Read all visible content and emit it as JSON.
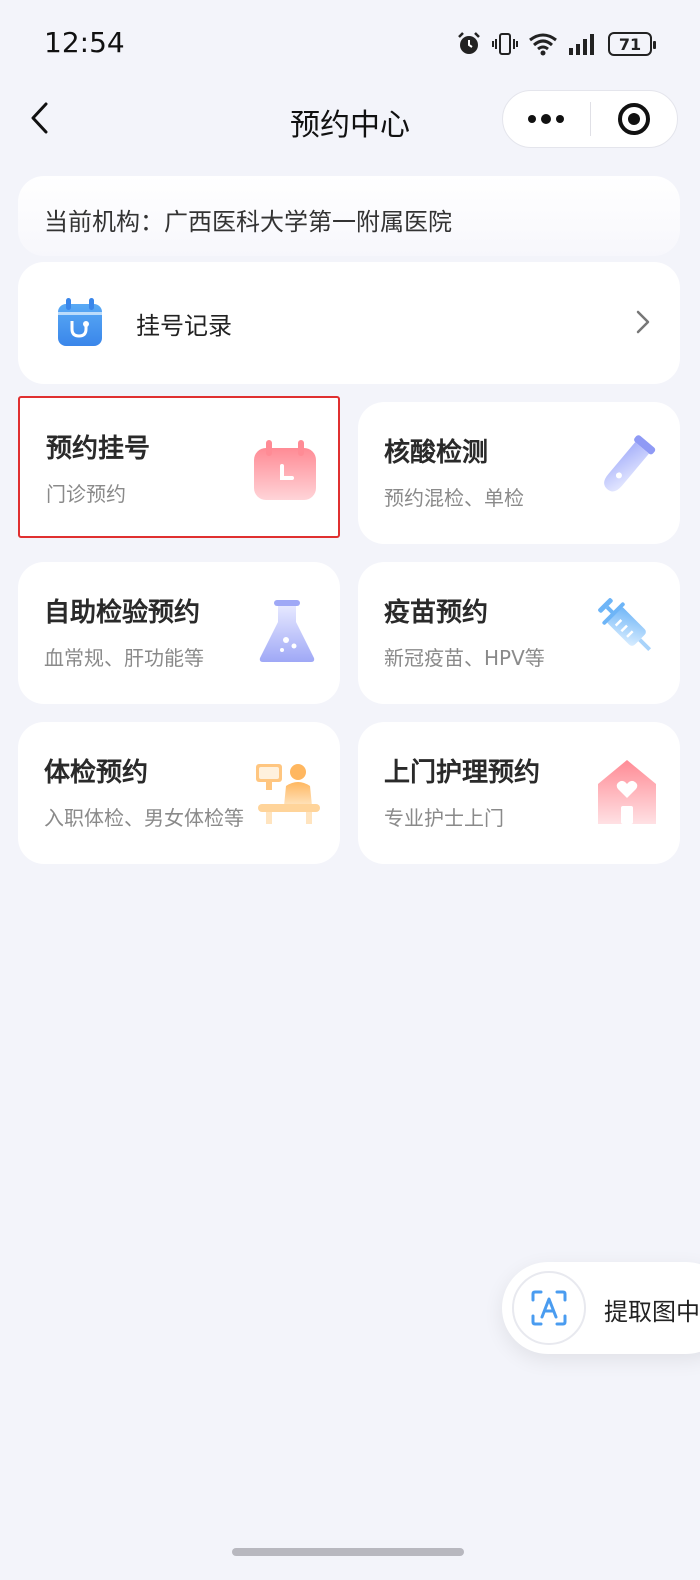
{
  "status_bar": {
    "time": "12:54",
    "battery": "71"
  },
  "nav": {
    "title": "预约中心"
  },
  "institution": {
    "text": "当前机构：广西医科大学第一附属医院"
  },
  "records": {
    "label": "挂号记录"
  },
  "services": [
    {
      "title": "预约挂号",
      "subtitle": "门诊预约",
      "icon": "calendar-icon"
    },
    {
      "title": "核酸检测",
      "subtitle": "预约混检、单检",
      "icon": "test-tube-icon"
    },
    {
      "title": "自助检验预约",
      "subtitle": "血常规、肝功能等",
      "icon": "flask-icon"
    },
    {
      "title": "疫苗预约",
      "subtitle": "新冠疫苗、HPV等",
      "icon": "syringe-icon"
    },
    {
      "title": "体检预约",
      "subtitle": "入职体检、男女体检等",
      "icon": "physical-exam-icon"
    },
    {
      "title": "上门护理预约",
      "subtitle": "专业护士上门",
      "icon": "home-care-icon"
    }
  ],
  "ocr": {
    "label": "提取图中"
  },
  "colors": {
    "selection": "#e03030",
    "background": "#f3f4fa",
    "accent_blue": "#4a9cf0"
  }
}
